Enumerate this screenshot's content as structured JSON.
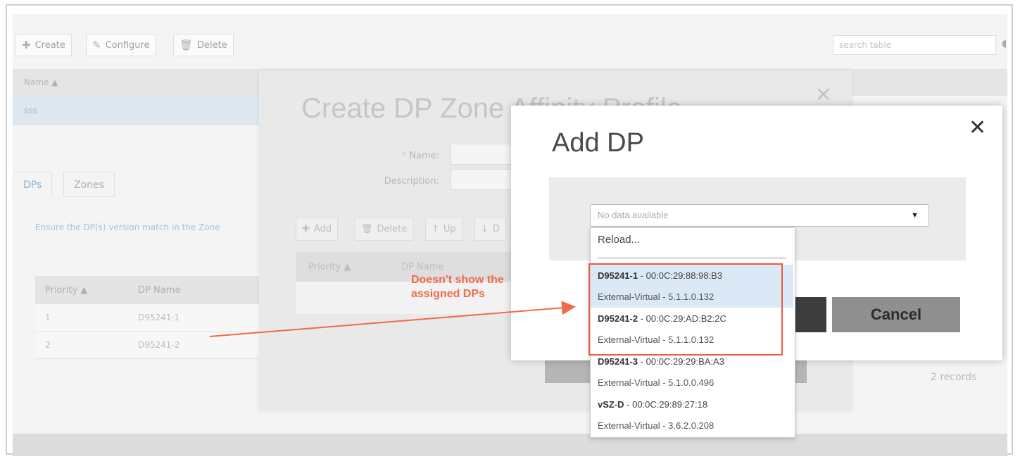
{
  "toolbar": {
    "create_label": "Create",
    "configure_label": "Configure",
    "delete_label": "Delete",
    "search_placeholder": "search table"
  },
  "main_grid": {
    "column_name": "Name ▲",
    "row_value": "sss"
  },
  "tabs": [
    {
      "label": "DPs",
      "active": true
    },
    {
      "label": "Zones",
      "active": false
    }
  ],
  "dps_panel": {
    "note": "Ensure the DP(s) version match in the Zone",
    "columns": [
      "Priority ▲",
      "DP Name"
    ],
    "rows": [
      {
        "priority": "1",
        "dp_name": "D95241-1"
      },
      {
        "priority": "2",
        "dp_name": "D95241-2"
      }
    ],
    "records": "2 records"
  },
  "create_dialog": {
    "title": "Create DP Zone Affinity Profile",
    "name_label": "Name:",
    "required_mark": "*",
    "description_label": "Description:",
    "add_label": "Add",
    "delete_label": "Delete",
    "up_label": "Up",
    "down_label": "D",
    "columns": [
      "Priority ▲",
      "DP Name"
    ]
  },
  "annotation": {
    "line1": "Doesn't show the",
    "line2": "assigned  DPs",
    "color": "#ef6a4a"
  },
  "add_dialog": {
    "title": "Add DP",
    "select_value": "No data available",
    "cancel_label": "Cancel",
    "reload_label": "Reload...",
    "options": [
      {
        "name": "D95241-1",
        "mac": " - 00:0C:29:88:98:B3",
        "detail": "External-Virtual - 5.1.1.0.132",
        "highlighted": true
      },
      {
        "name": "D95241-2",
        "mac": " - 00:0C:29:AD:B2:2C",
        "detail": "External-Virtual - 5.1.1.0.132",
        "highlighted": false
      },
      {
        "name": "D95241-3",
        "mac": " - 00:0C:29:29:BA:A3",
        "detail": "External-Virtual - 5.1.0.0.496",
        "highlighted": false
      },
      {
        "name": "vSZ-D",
        "mac": " - 00:0C:29:89:27:18",
        "detail": "External-Virtual - 3.6.2.0.208",
        "highlighted": false
      }
    ]
  }
}
